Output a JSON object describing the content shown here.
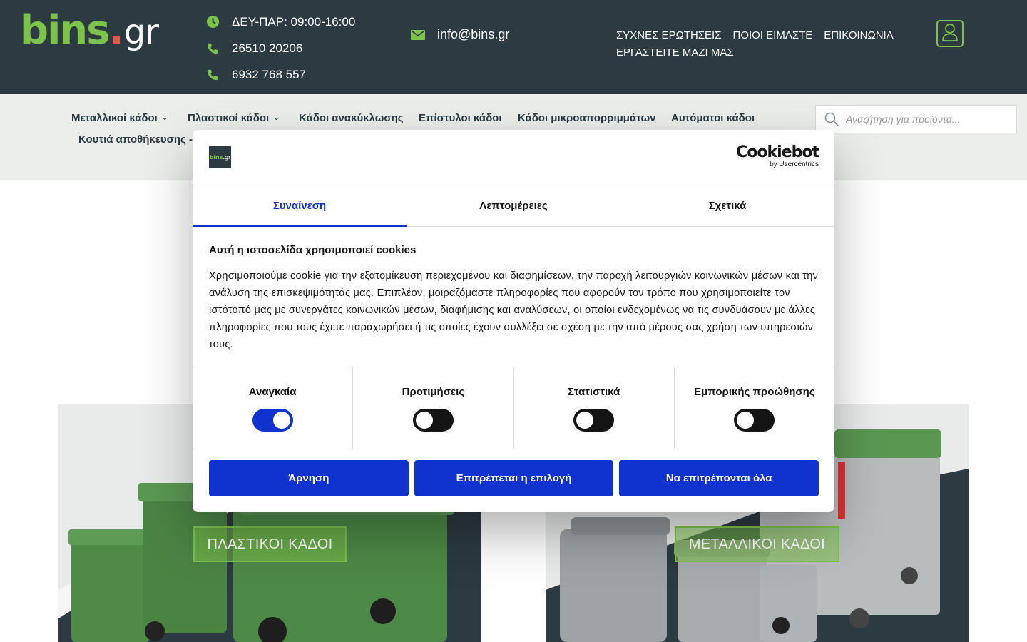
{
  "brand": {
    "logo_main": "bins",
    "logo_dot": ".",
    "logo_tld": "gr"
  },
  "contact": {
    "hours": "ΔΕΥ-ΠΑΡ: 09:00-16:00",
    "phone1": "26510 20206",
    "phone2": "6932 768 557",
    "email": "info@bins.gr"
  },
  "top_nav": {
    "faq": "ΣΥΧΝΕΣ ΕΡΩΤΗΣΕΙΣ",
    "about": "ΠΟΙΟΙ ΕΙΜΑΣΤΕ",
    "contact": "ΕΠΙΚΟΙΝΩΝΙΑ",
    "careers": "ΕΡΓΑΣΤΕΙΤΕ ΜΑΖΙ ΜΑΣ"
  },
  "categories": {
    "metal": "Μεταλλικοί κάδοι",
    "plastic": "Πλαστικοί κάδοι",
    "recycling": "Κάδοι ανακύκλωσης",
    "wall": "Επίστυλοι κάδοι",
    "small": "Κάδοι μικροαπορριμμάτων",
    "automatic": "Αυτόματοι κάδοι",
    "storage": "Κουτιά αποθήκευσης -"
  },
  "search": {
    "placeholder": "Αναζήτηση για προϊόντα..."
  },
  "tiles": {
    "plastic_label": "ΠΛΑΣΤΙΚΟΙ ΚΑΔΟΙ",
    "metal_label": "ΜΕΤΑΛΛΙΚΟΙ ΚΑΔΟΙ"
  },
  "cookie": {
    "provider_line1": "Cookiebot",
    "provider_line2": "by Usercentrics",
    "logo_text_main": "bins",
    "logo_text_tld": ".gr",
    "tabs": [
      "Συναίνεση",
      "Λεπτομέρειες",
      "Σχετικά"
    ],
    "title": "Αυτή η ιστοσελίδα χρησιμοποιεί cookies",
    "body": "Χρησιμοποιούμε cookie για την εξατομίκευση περιεχομένου και διαφημίσεων, την παροχή λειτουργιών κοινωνικών μέσων και την ανάλυση της επισκεψιμότητάς μας. Επιπλέον, μοιραζόμαστε πληροφορίες που αφορούν τον τρόπο που χρησιμοποιείτε τον ιστότοπό μας με συνεργάτες κοινωνικών μέσων, διαφήμισης και αναλύσεων, οι οποίοι ενδεχομένως να τις συνδυάσουν με άλλες πληροφορίες που τους έχετε παραχωρήσει ή τις οποίες έχουν συλλέξει σε σχέση με την από μέρους σας χρήση των υπηρεσιών τους.",
    "toggles": [
      {
        "label": "Αναγκαία",
        "on": true
      },
      {
        "label": "Προτιμήσεις",
        "on": false
      },
      {
        "label": "Στατιστικά",
        "on": false
      },
      {
        "label": "Εμπορικής προώθησης",
        "on": false
      }
    ],
    "buttons": {
      "deny": "Άρνηση",
      "allow_selection": "Επιτρέπεται η επιλογή",
      "allow_all": "Να επιτρέπονται όλα"
    }
  },
  "colors": {
    "header_bg": "#2c3a41",
    "accent_green": "#7dc24b",
    "cookie_blue": "#1032cf",
    "nav_bg": "#eceeec"
  }
}
